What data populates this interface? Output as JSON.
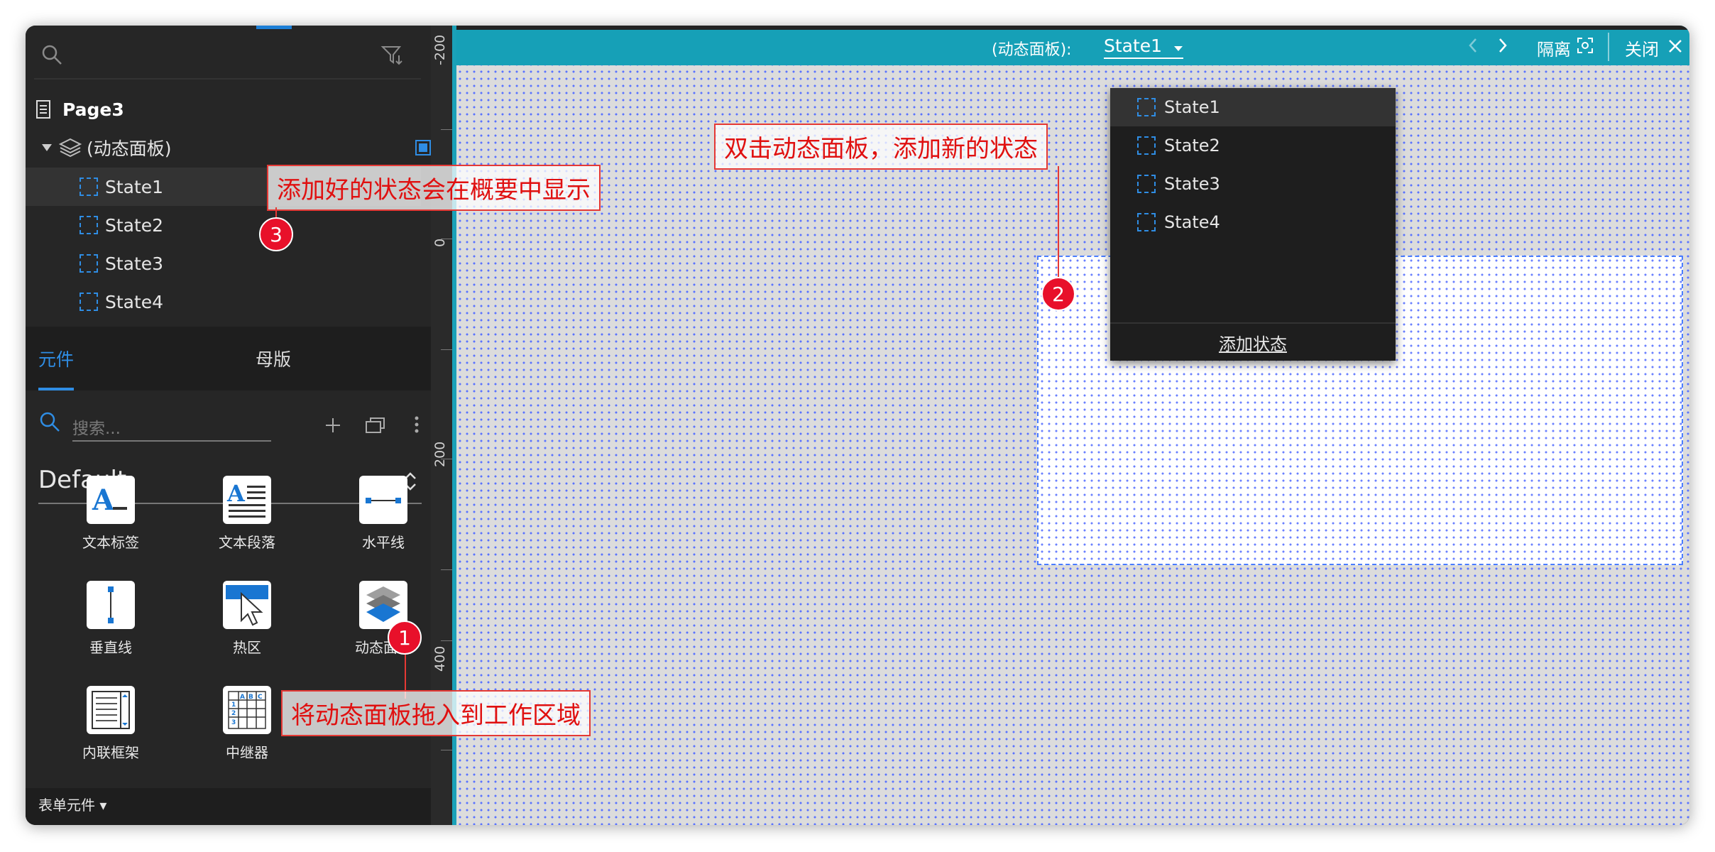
{
  "outline": {
    "page_label": "Page3",
    "panel_label": "(动态面板)",
    "states": [
      "State1",
      "State2",
      "State3",
      "State4"
    ]
  },
  "library": {
    "tabs": [
      "元件",
      "母版"
    ],
    "search_placeholder": "搜索...",
    "library_name": "Default",
    "widgets": [
      {
        "label": "文本标签",
        "icon": "text-label-icon"
      },
      {
        "label": "文本段落",
        "icon": "text-paragraph-icon"
      },
      {
        "label": "水平线",
        "icon": "horizontal-line-icon"
      },
      {
        "label": "垂直线",
        "icon": "vertical-line-icon"
      },
      {
        "label": "热区",
        "icon": "hotspot-icon"
      },
      {
        "label": "动态面板",
        "icon": "dynamic-panel-icon"
      },
      {
        "label": "内联框架",
        "icon": "inline-frame-icon"
      },
      {
        "label": "中继器",
        "icon": "repeater-icon"
      }
    ],
    "bottom_label": "表单元件 ▾"
  },
  "ruler": {
    "labels": [
      "-200",
      "0",
      "200",
      "400"
    ]
  },
  "toolbar": {
    "panel_label": "(动态面板):",
    "current_state": "State1",
    "isolate_label": "隔离",
    "close_label": "关闭"
  },
  "dropdown": {
    "states": [
      "State1",
      "State2",
      "State3",
      "State4"
    ],
    "add_label": "添加状态"
  },
  "annotations": {
    "note1": "将动态面板拖入到工作区域",
    "note2": "双击动态面板，添加新的状态",
    "note3": "添加好的状态会在概要中显示",
    "badges": [
      "1",
      "2",
      "3"
    ]
  },
  "colors": {
    "accent": "#1aa1b8",
    "highlight": "#2f8de4",
    "annotation": "#e53935"
  }
}
